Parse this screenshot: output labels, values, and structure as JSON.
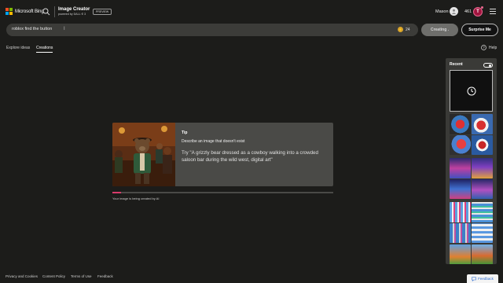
{
  "header": {
    "logo_text": "Microsoft Bing",
    "app_title": "Image Creator",
    "app_subtitle": "powered by DALL·E 3",
    "preview_badge": "PREVIEW",
    "user_name": "Mason",
    "points": "461",
    "reward_letter": "T",
    "icons": [
      "search-icon",
      "user-icon",
      "menu-icon"
    ]
  },
  "prompt": {
    "value": "roblox find the button",
    "boosts": "24",
    "creating_label": "Creating .",
    "surprise_label": "Surprise Me"
  },
  "tabs": [
    {
      "label": "Explore ideas",
      "active": false
    },
    {
      "label": "Creations",
      "active": true
    }
  ],
  "help": {
    "label": "Help"
  },
  "tip": {
    "title": "Tip",
    "subtitle": "Describe an image that doesn't exist",
    "example": "Try \"A grizzly bear dressed as a cowboy walking into a crowded saloon bar during the wild west, digital art\""
  },
  "progress": {
    "fraction": 0.04,
    "status_text": "Your image is being created by AI"
  },
  "recent": {
    "title": "Recent",
    "toggle_on": true
  },
  "footer": {
    "links": [
      "Privacy and Cookies",
      "Content Policy",
      "Terms of Use",
      "Feedback"
    ],
    "feedback_button": "Feedback"
  },
  "colors": {
    "background": "#1c1c1a",
    "accent_pink": "#d83b6b",
    "card": "#4a4a47"
  }
}
